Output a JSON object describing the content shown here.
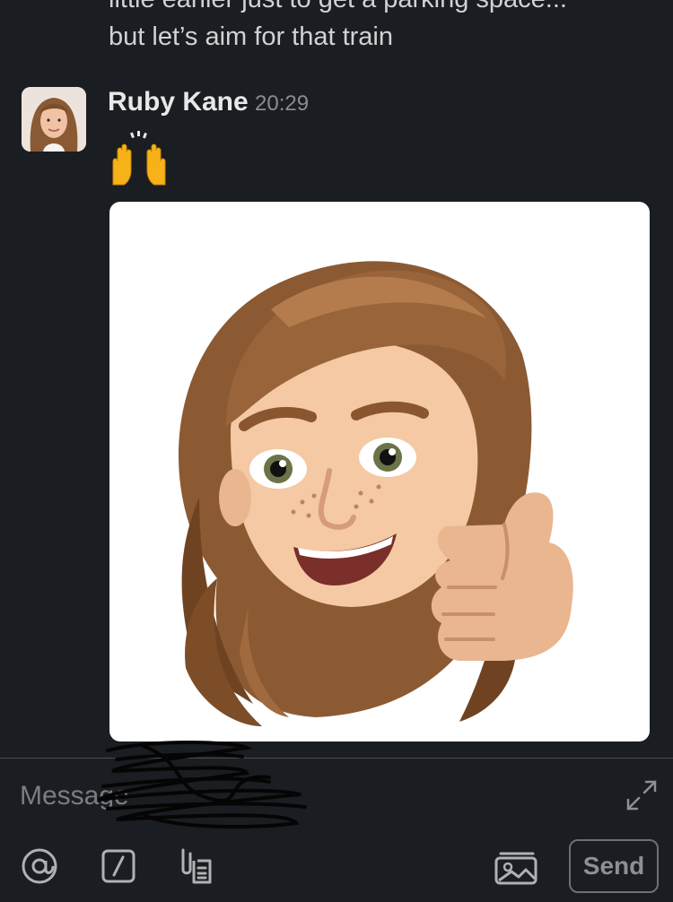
{
  "message_previous": {
    "lines": [
      "little earlier just to get a parking space...",
      "but let’s aim for that train"
    ]
  },
  "message": {
    "sender": "Ruby Kane",
    "time": "20:29",
    "emoji_icon": "raising-hands-icon",
    "image_description_icon": "memoji-thumbs-up-image"
  },
  "composer": {
    "placeholder": "Message"
  },
  "toolbar": {
    "mention_icon": "at-icon",
    "command_icon": "slash-icon",
    "attach_icon": "attachment-icon",
    "photo_icon": "photo-gallery-icon",
    "send_label": "Send"
  },
  "colors": {
    "background": "#1a1d21",
    "text": "#d1d2d3",
    "muted": "#8b8c8e",
    "divider": "#4a4c50"
  }
}
